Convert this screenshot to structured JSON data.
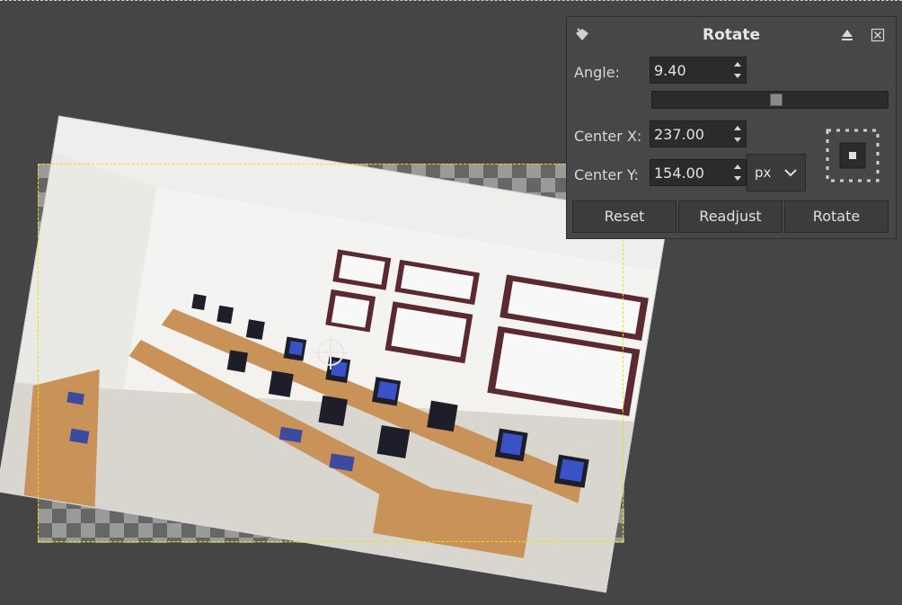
{
  "dialog": {
    "title": "Rotate",
    "icon": "rotate-tool-icon",
    "angle_label": "Angle:",
    "angle_value": "9.40",
    "angle_slider_fraction": 0.53,
    "center_x_label": "Center X:",
    "center_x_value": "237.00",
    "center_y_label": "Center Y:",
    "center_y_value": "154.00",
    "unit_value": "px",
    "buttons": {
      "reset": "Reset",
      "readjust": "Readjust",
      "rotate": "Rotate"
    }
  },
  "canvas": {
    "rotation_degrees": 9.4,
    "selection_color": "#f0e000"
  },
  "colors": {
    "background": "#454545",
    "dialog_bg": "#474747"
  }
}
